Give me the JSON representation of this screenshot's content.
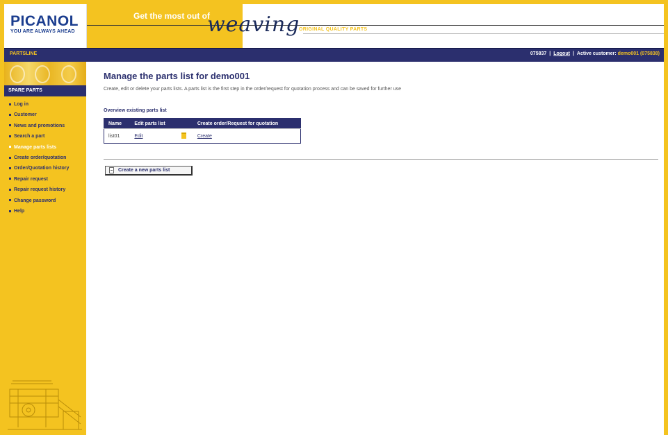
{
  "header": {
    "logo_text": "PICANOL",
    "logo_tagline": "YOU ARE ALWAYS AHEAD",
    "banner_headline": "Get the most out of",
    "banner_script": "weaving",
    "banner_tagline": "ORIGINAL QUALITY PARTS"
  },
  "navbar": {
    "brand": "PARTSLINE",
    "customer_id": "075837",
    "logout_label": "Logout",
    "active_customer_label": "Active customer:",
    "active_customer_value": "demo001 (075838)"
  },
  "sidebar": {
    "heading": "SPARE PARTS",
    "items": [
      {
        "label": "Log in",
        "active": false
      },
      {
        "label": "Customer",
        "active": false
      },
      {
        "label": "News and promotions",
        "active": false
      },
      {
        "label": "Search a part",
        "active": false
      },
      {
        "label": "Manage parts lists",
        "active": true
      },
      {
        "label": "Create order/quotation",
        "active": false
      },
      {
        "label": "Order/Quotation history",
        "active": false
      },
      {
        "label": "Repair request",
        "active": false
      },
      {
        "label": "Repair request history",
        "active": false
      },
      {
        "label": "Change password",
        "active": false
      },
      {
        "label": "Help",
        "active": false
      }
    ]
  },
  "main": {
    "title": "Manage the parts list for demo001",
    "intro": "Create, edit or delete your parts lists. A parts list is the first step in the order/request for quotation process and can be saved for further use",
    "overview_label": "Overview existing parts list",
    "table": {
      "columns": [
        "Name",
        "Edit parts list",
        "",
        "Create order/Request for quotation"
      ],
      "rows": [
        {
          "name": "list01",
          "edit": "Edit",
          "delete_icon": "trash-icon",
          "create": "Create"
        }
      ]
    },
    "new_list_button": "Create a new parts list"
  },
  "colors": {
    "brand_yellow": "#f4c320",
    "brand_navy": "#2b2f6e",
    "logo_blue": "#1a3c8e"
  }
}
